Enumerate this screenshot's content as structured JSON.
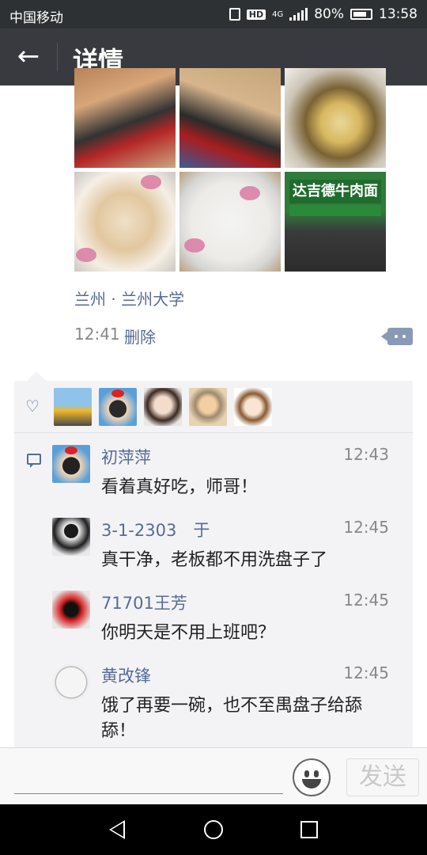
{
  "status_bar": {
    "carrier": "中国移动",
    "hd_badge": "HD",
    "network": "4G",
    "battery": "80%",
    "time": "13:58"
  },
  "header": {
    "title": "详情"
  },
  "post": {
    "location": "兰州 · 兰州大学",
    "time": "12:41",
    "delete_label": "删除",
    "store_sign": "达吉德牛肉面"
  },
  "comments": [
    {
      "name": "初萍萍",
      "time": "12:43",
      "text": "看着真好吃，师哥！"
    },
    {
      "name": "3-1-2303　于",
      "time": "12:45",
      "text": "真干净，老板都不用洗盘子了"
    },
    {
      "name": "71701王芳",
      "time": "12:45",
      "text": "你明天是不用上班吧？"
    },
    {
      "name": "黄改锋",
      "time": "12:45",
      "text": "饿了再要一碗，也不至禺盘子给舔舔！"
    }
  ],
  "input": {
    "value": "",
    "send_label": "发送"
  },
  "colors": {
    "link": "#576b95",
    "titlebar": "#393a3f",
    "statusbar": "#2e3133",
    "panel": "#f3f3f5",
    "input_underline": "#4caf50"
  }
}
